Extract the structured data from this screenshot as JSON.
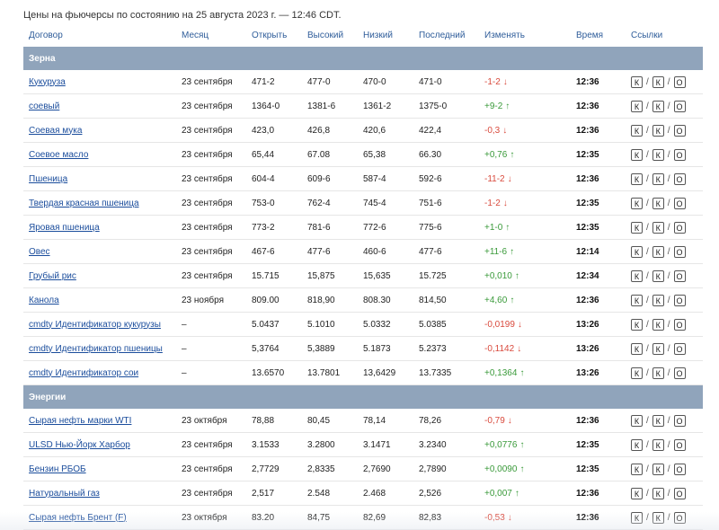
{
  "headline": "Цены на фьючерсы по состоянию на 25 августа 2023 г. — 12:46 CDT.",
  "columns": [
    "Договор",
    "Месяц",
    "Открыть",
    "Высокий",
    "Низкий",
    "Последний",
    "Изменять",
    "Время",
    "Ссылки"
  ],
  "link_letters": [
    "К",
    "К",
    "О"
  ],
  "link_separator": "/",
  "colors": {
    "section_bg": "#90a4bb",
    "link": "#1b4d9c",
    "negative": "#d94a3d",
    "positive": "#3a9a3a",
    "header_text": "#2f5d9a"
  },
  "icons": {
    "down": "arrow-down-icon",
    "up": "arrow-up-icon"
  },
  "sections": [
    {
      "title": "Зерна",
      "rows": [
        {
          "contract": "Кукуруза",
          "month": "23 сентября",
          "open": "471-2",
          "high": "477-0",
          "low": "470-0",
          "last": "471-0",
          "change": "-1-2",
          "dir": "down",
          "time": "12:36"
        },
        {
          "contract": "соевый",
          "month": "23 сентября",
          "open": "1364-0",
          "high": "1381-6",
          "low": "1361-2",
          "last": "1375-0",
          "change": "+9-2",
          "dir": "up",
          "time": "12:36"
        },
        {
          "contract": "Соевая мука",
          "month": "23 сентября",
          "open": "423,0",
          "high": "426,8",
          "low": "420,6",
          "last": "422,4",
          "change": "-0,3",
          "dir": "down",
          "time": "12:36"
        },
        {
          "contract": "Соевое масло",
          "month": "23 сентября",
          "open": "65,44",
          "high": "67.08",
          "low": "65,38",
          "last": "66.30",
          "change": "+0,76",
          "dir": "up",
          "time": "12:35"
        },
        {
          "contract": "Пшеница",
          "month": "23 сентября",
          "open": "604-4",
          "high": "609-6",
          "low": "587-4",
          "last": "592-6",
          "change": "-11-2",
          "dir": "down",
          "time": "12:36"
        },
        {
          "contract": "Твердая красная пшеница",
          "month": "23 сентября",
          "open": "753-0",
          "high": "762-4",
          "low": "745-4",
          "last": "751-6",
          "change": "-1-2",
          "dir": "down",
          "time": "12:35"
        },
        {
          "contract": "Яровая пшеница",
          "month": "23 сентября",
          "open": "773-2",
          "high": "781-6",
          "low": "772-6",
          "last": "775-6",
          "change": "+1-0",
          "dir": "up",
          "time": "12:35"
        },
        {
          "contract": "Овес",
          "month": "23 сентября",
          "open": "467-6",
          "high": "477-6",
          "low": "460-6",
          "last": "477-6",
          "change": "+11-6",
          "dir": "up",
          "time": "12:14"
        },
        {
          "contract": "Грубый рис",
          "month": "23 сентября",
          "open": "15.715",
          "high": "15,875",
          "low": "15,635",
          "last": "15.725",
          "change": "+0,010",
          "dir": "up",
          "time": "12:34"
        },
        {
          "contract": "Канола",
          "month": "23 ноября",
          "open": "809.00",
          "high": "818,90",
          "low": "808.30",
          "last": "814,50",
          "change": "+4,60",
          "dir": "up",
          "time": "12:36"
        },
        {
          "contract": "cmdty Идентификатор кукурузы",
          "month": "–",
          "open": "5.0437",
          "high": "5.1010",
          "low": "5.0332",
          "last": "5.0385",
          "change": "-0,0199",
          "dir": "down",
          "time": "13:26"
        },
        {
          "contract": "cmdty Идентификатор пшеницы",
          "month": "–",
          "open": "5,3764",
          "high": "5,3889",
          "low": "5.1873",
          "last": "5.2373",
          "change": "-0,1142",
          "dir": "down",
          "time": "13:26"
        },
        {
          "contract": "cmdty Идентификатор сои",
          "month": "–",
          "open": "13.6570",
          "high": "13.7801",
          "low": "13,6429",
          "last": "13.7335",
          "change": "+0,1364",
          "dir": "up",
          "time": "13:26"
        }
      ]
    },
    {
      "title": "Энергии",
      "rows": [
        {
          "contract": "Сырая нефть марки WTI",
          "month": "23 октября",
          "open": "78,88",
          "high": "80,45",
          "low": "78,14",
          "last": "78,26",
          "change": "-0,79",
          "dir": "down",
          "time": "12:36"
        },
        {
          "contract": "ULSD Нью-Йорк Харбор",
          "month": "23 сентября",
          "open": "3.1533",
          "high": "3.2800",
          "low": "3.1471",
          "last": "3.2340",
          "change": "+0,0776",
          "dir": "up",
          "time": "12:35"
        },
        {
          "contract": "Бензин РБОБ",
          "month": "23 сентября",
          "open": "2,7729",
          "high": "2,8335",
          "low": "2,7690",
          "last": "2,7890",
          "change": "+0,0090",
          "dir": "up",
          "time": "12:35"
        },
        {
          "contract": "Натуральный газ",
          "month": "23 сентября",
          "open": "2,517",
          "high": "2.548",
          "low": "2.468",
          "last": "2,526",
          "change": "+0,007",
          "dir": "up",
          "time": "12:36"
        },
        {
          "contract": "Сырая нефть Брент (F)",
          "month": "23 октября",
          "open": "83.20",
          "high": "84,75",
          "low": "82,69",
          "last": "82,83",
          "change": "-0,53",
          "dir": "down",
          "time": "12:36"
        }
      ]
    }
  ]
}
